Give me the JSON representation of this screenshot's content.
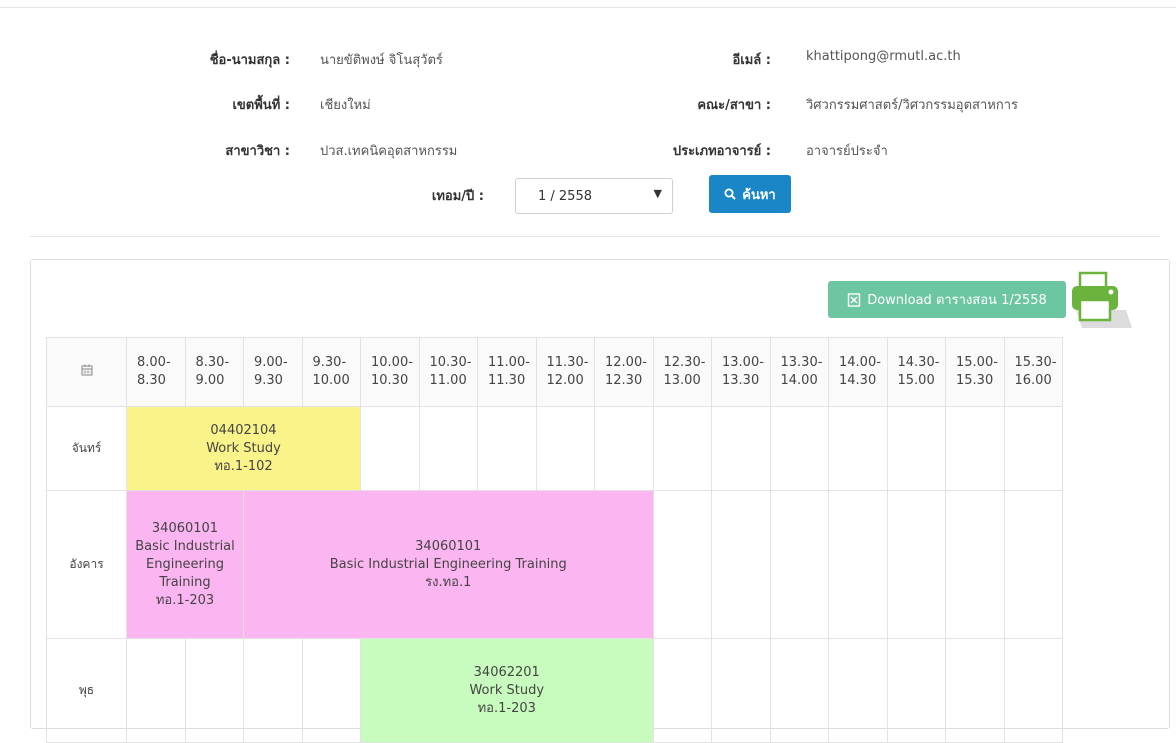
{
  "profile": {
    "name_label": "ชื่อ-นามสกุล :",
    "name_value": "นายขัติพงษ์ จิโนสุวัตร์",
    "email_label": "อีเมล์ :",
    "email_value": "khattipong@rmutl.ac.th",
    "area_label": "เขตพื้นที่ :",
    "area_value": "เชียงใหม่",
    "faculty_label": "คณะ/สาขา :",
    "faculty_value": "วิศวกรรมศาสตร์/วิศวกรรมอุตสาหการ",
    "program_label": "สาขาวิชา :",
    "program_value": "ปวส.เทคนิคอุตสาหกรรม",
    "type_label": "ประเภทอาจารย์ :",
    "type_value": "อาจารย์ประจำ"
  },
  "search": {
    "term_label": "เทอม/ปี :",
    "term_value": "1 / 2558",
    "button_label": "ค้นหา"
  },
  "download": {
    "label": "Download ตารางสอน 1/2558"
  },
  "timetable": {
    "time_slots": [
      [
        "8.00-",
        "8.30"
      ],
      [
        "8.30-",
        "9.00"
      ],
      [
        "9.00-",
        "9.30"
      ],
      [
        "9.30-",
        "10.00"
      ],
      [
        "10.00-",
        "10.30"
      ],
      [
        "10.30-",
        "11.00"
      ],
      [
        "11.00-",
        "11.30"
      ],
      [
        "11.30-",
        "12.00"
      ],
      [
        "12.00-",
        "12.30"
      ],
      [
        "12.30-",
        "13.00"
      ],
      [
        "13.00-",
        "13.30"
      ],
      [
        "13.30-",
        "14.00"
      ],
      [
        "14.00-",
        "14.30"
      ],
      [
        "14.30-",
        "15.00"
      ],
      [
        "15.00-",
        "15.30"
      ],
      [
        "15.30-",
        "16.00"
      ]
    ],
    "days": [
      {
        "day": "จันทร์",
        "cells": [
          {
            "span": 4,
            "color": "yellow",
            "code": "04402104",
            "title": "Work Study",
            "room": "ทอ.1-102"
          },
          {
            "span": 1
          },
          {
            "span": 1
          },
          {
            "span": 1
          },
          {
            "span": 1
          },
          {
            "span": 1
          },
          {
            "span": 1
          },
          {
            "span": 1
          },
          {
            "span": 1
          },
          {
            "span": 1
          },
          {
            "span": 1
          },
          {
            "span": 1
          },
          {
            "span": 1
          }
        ]
      },
      {
        "day": "อังคาร",
        "cells": [
          {
            "span": 2,
            "color": "pink",
            "code": "34060101",
            "title": "Basic Industrial Engineering Training",
            "room": "ทอ.1-203"
          },
          {
            "span": 7,
            "color": "pink",
            "code": "34060101",
            "title": "Basic Industrial Engineering Training",
            "room": "รง.ทอ.1"
          },
          {
            "span": 1
          },
          {
            "span": 1
          },
          {
            "span": 1
          },
          {
            "span": 1
          },
          {
            "span": 1
          },
          {
            "span": 1
          },
          {
            "span": 1
          }
        ]
      },
      {
        "day": "พุธ",
        "cells": [
          {
            "span": 1
          },
          {
            "span": 1
          },
          {
            "span": 1
          },
          {
            "span": 1
          },
          {
            "span": 5,
            "color": "green",
            "code": "34062201",
            "title": "Work Study",
            "room": "ทอ.1-203"
          },
          {
            "span": 1
          },
          {
            "span": 1
          },
          {
            "span": 1
          },
          {
            "span": 1
          },
          {
            "span": 1
          },
          {
            "span": 1
          },
          {
            "span": 1
          }
        ]
      }
    ]
  }
}
